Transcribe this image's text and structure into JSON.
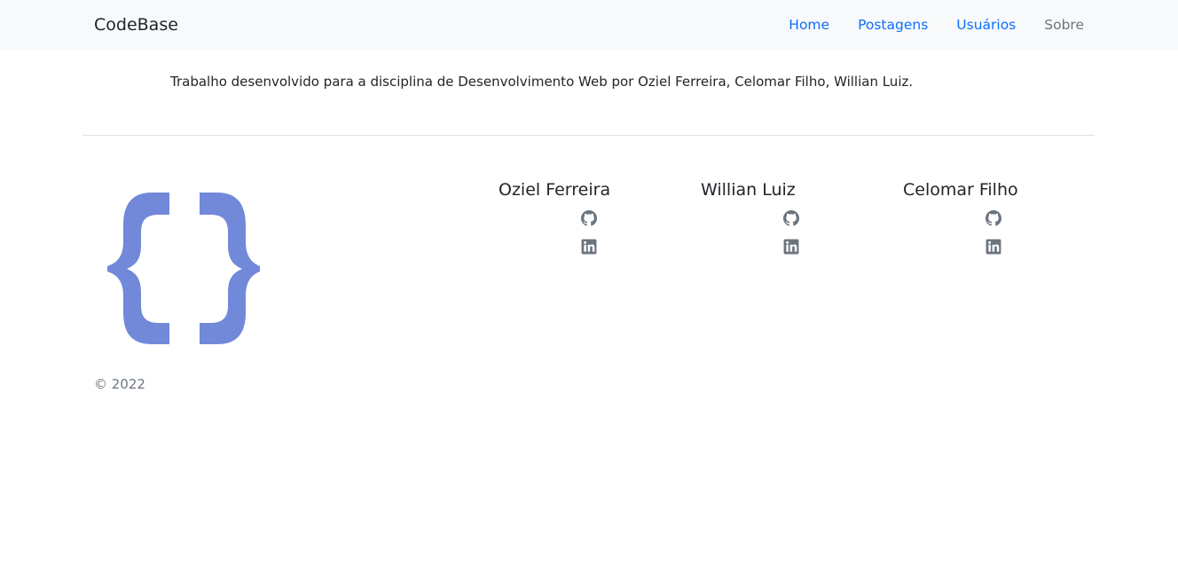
{
  "navbar": {
    "brand": "CodeBase",
    "links": [
      {
        "label": "Home",
        "active": false
      },
      {
        "label": "Postagens",
        "active": false
      },
      {
        "label": "Usuários",
        "active": false
      },
      {
        "label": "Sobre",
        "active": true
      }
    ]
  },
  "intro": {
    "text": "Trabalho desenvolvido para a disciplina de Desenvolvimento Web por Oziel Ferreira, Celomar Filho, Willian Luiz."
  },
  "footer": {
    "logo_icon": "curly-braces-icon",
    "copyright": "© 2022",
    "authors": [
      {
        "name": "Oziel Ferreira",
        "icons": [
          "github-icon",
          "linkedin-icon"
        ]
      },
      {
        "name": "Willian Luiz",
        "icons": [
          "github-icon",
          "linkedin-icon"
        ]
      },
      {
        "name": "Celomar Filho",
        "icons": [
          "github-icon",
          "linkedin-icon"
        ]
      }
    ]
  },
  "colors": {
    "navbar_bg": "#f8f9fa",
    "link": "#0d6efd",
    "link_active": "#6c757d",
    "logo": "#7289da",
    "icon": "#6c757d",
    "divider": "#dee2e6"
  }
}
